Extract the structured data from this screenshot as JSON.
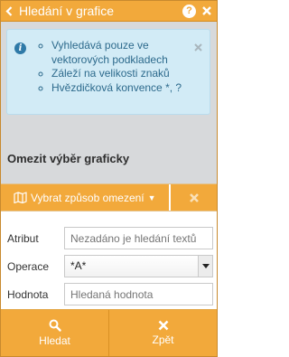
{
  "header": {
    "title": "Hledání v grafice",
    "back_icon": "chevron-left-icon",
    "help_icon": "question-circle-icon",
    "help_glyph": "?",
    "close_icon": "close-icon"
  },
  "alert": {
    "icon": "info-icon",
    "icon_glyph": "i",
    "items": [
      "Vyhledává pouze ve vektorových podkladech",
      "Záleží na velikosti znaků",
      "Hvězdičková konvence *, ?"
    ]
  },
  "section": {
    "title": "Omezit výběr graficky",
    "dropdown_label": "Vybrat způsob omezení",
    "dropdown_icon": "map-icon",
    "clear_icon": "close-icon"
  },
  "form": {
    "attribute_label": "Atribut",
    "attribute_placeholder": "Nezadáno je hledání textů",
    "operation_label": "Operace",
    "operation_value": "*A*",
    "value_label": "Hodnota",
    "value_placeholder": "Hledaná hodnota"
  },
  "footer": {
    "search_label": "Hledat",
    "search_icon": "search-icon",
    "back_label": "Zpět",
    "back_icon": "close-icon"
  },
  "colors": {
    "accent": "#f2a93b",
    "alert_bg": "#d2ebf6",
    "alert_text": "#2d6a8c",
    "panel_bg": "#d7d9db"
  }
}
